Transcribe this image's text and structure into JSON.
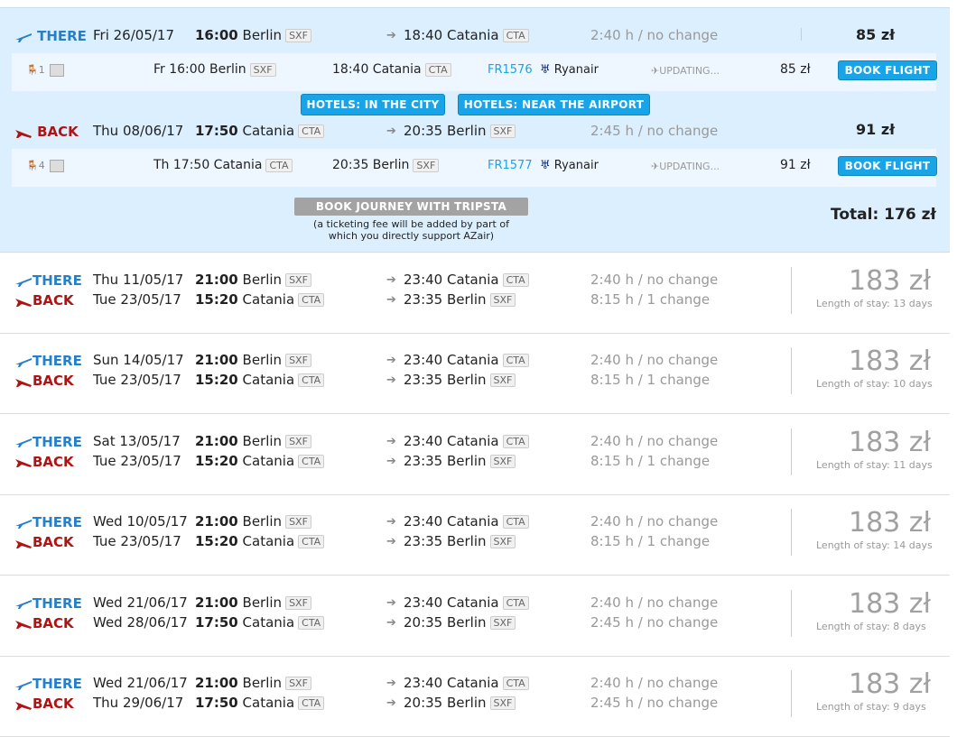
{
  "selected": {
    "there": {
      "label": "THERE",
      "date": "Fri 26/05/17",
      "dep_time": "16:00",
      "dep_city": "Berlin",
      "dep_code": "SXF",
      "arr": "18:40 Catania",
      "arr_code": "CTA",
      "duration": "2:40 h / no change",
      "price": "85 zł",
      "detail": {
        "seats": "1",
        "dep": "Fr 16:00 Berlin",
        "dep_code": "SXF",
        "arr": "18:40 Catania",
        "arr_code": "CTA",
        "flight_no": "FR1576",
        "airline": "Ryanair",
        "status": "UPDATING...",
        "price": "85 zł",
        "book_label": "BOOK FLIGHT"
      }
    },
    "hotels_city_label": "HOTELS: IN THE CITY",
    "hotels_airport_label": "HOTELS: NEAR THE AIRPORT",
    "back": {
      "label": "BACK",
      "date": "Thu 08/06/17",
      "dep_time": "17:50",
      "dep_city": "Catania",
      "dep_code": "CTA",
      "arr": "20:35 Berlin",
      "arr_code": "SXF",
      "duration": "2:45 h / no change",
      "price": "91 zł",
      "detail": {
        "seats": "4",
        "dep": "Th 17:50 Catania",
        "dep_code": "CTA",
        "arr": "20:35 Berlin",
        "arr_code": "SXF",
        "flight_no": "FR1577",
        "airline": "Ryanair",
        "status": "UPDATING...",
        "price": "91 zł",
        "book_label": "BOOK FLIGHT"
      }
    },
    "book_journey_label": "BOOK JOURNEY WITH TRIPSTA",
    "fee_note_1": "(a ticketing fee will be added by part of",
    "fee_note_2": "which you directly support AZair)",
    "total": "Total: 176 zł"
  },
  "results": [
    {
      "there_date": "Thu 11/05/17",
      "there_time": "21:00",
      "there_city": "Berlin",
      "there_code": "SXF",
      "there_arr": "23:40 Catania",
      "there_arr_code": "CTA",
      "there_dur": "2:40 h / no change",
      "back_date": "Tue 23/05/17",
      "back_time": "15:20",
      "back_city": "Catania",
      "back_code": "CTA",
      "back_arr": "23:35 Berlin",
      "back_arr_code": "SXF",
      "back_dur": "8:15 h / 1 change",
      "price": "183 zł",
      "stay": "Length of stay: 13 days"
    },
    {
      "there_date": "Sun 14/05/17",
      "there_time": "21:00",
      "there_city": "Berlin",
      "there_code": "SXF",
      "there_arr": "23:40 Catania",
      "there_arr_code": "CTA",
      "there_dur": "2:40 h / no change",
      "back_date": "Tue 23/05/17",
      "back_time": "15:20",
      "back_city": "Catania",
      "back_code": "CTA",
      "back_arr": "23:35 Berlin",
      "back_arr_code": "SXF",
      "back_dur": "8:15 h / 1 change",
      "price": "183 zł",
      "stay": "Length of stay: 10 days"
    },
    {
      "there_date": "Sat 13/05/17",
      "there_time": "21:00",
      "there_city": "Berlin",
      "there_code": "SXF",
      "there_arr": "23:40 Catania",
      "there_arr_code": "CTA",
      "there_dur": "2:40 h / no change",
      "back_date": "Tue 23/05/17",
      "back_time": "15:20",
      "back_city": "Catania",
      "back_code": "CTA",
      "back_arr": "23:35 Berlin",
      "back_arr_code": "SXF",
      "back_dur": "8:15 h / 1 change",
      "price": "183 zł",
      "stay": "Length of stay: 11 days"
    },
    {
      "there_date": "Wed 10/05/17",
      "there_time": "21:00",
      "there_city": "Berlin",
      "there_code": "SXF",
      "there_arr": "23:40 Catania",
      "there_arr_code": "CTA",
      "there_dur": "2:40 h / no change",
      "back_date": "Tue 23/05/17",
      "back_time": "15:20",
      "back_city": "Catania",
      "back_code": "CTA",
      "back_arr": "23:35 Berlin",
      "back_arr_code": "SXF",
      "back_dur": "8:15 h / 1 change",
      "price": "183 zł",
      "stay": "Length of stay: 14 days"
    },
    {
      "there_date": "Wed 21/06/17",
      "there_time": "21:00",
      "there_city": "Berlin",
      "there_code": "SXF",
      "there_arr": "23:40 Catania",
      "there_arr_code": "CTA",
      "there_dur": "2:40 h / no change",
      "back_date": "Wed 28/06/17",
      "back_time": "17:50",
      "back_city": "Catania",
      "back_code": "CTA",
      "back_arr": "20:35 Berlin",
      "back_arr_code": "SXF",
      "back_dur": "2:45 h / no change",
      "price": "183 zł",
      "stay": "Length of stay: 8 days"
    },
    {
      "there_date": "Wed 21/06/17",
      "there_time": "21:00",
      "there_city": "Berlin",
      "there_code": "SXF",
      "there_arr": "23:40 Catania",
      "there_arr_code": "CTA",
      "there_dur": "2:40 h / no change",
      "back_date": "Thu 29/06/17",
      "back_time": "17:50",
      "back_city": "Catania",
      "back_code": "CTA",
      "back_arr": "20:35 Berlin",
      "back_arr_code": "SXF",
      "back_dur": "2:45 h / no change",
      "price": "183 zł",
      "stay": "Length of stay: 9 days"
    }
  ],
  "labels": {
    "there": "THERE",
    "back": "BACK"
  },
  "icons": {
    "there": "plane-takeoff-icon",
    "back": "plane-landing-icon",
    "arrow": "arrow-right-icon",
    "seat": "seat-icon",
    "photo": "photo-icon",
    "airline": "ryanair-logo-icon",
    "updating": "plane-updating-icon"
  },
  "colors": {
    "there": "#2680c9",
    "back": "#b01313",
    "book_button": "#1aa4e8",
    "selected_bg": "#dcefff",
    "price_gray": "#a0a0a0"
  }
}
